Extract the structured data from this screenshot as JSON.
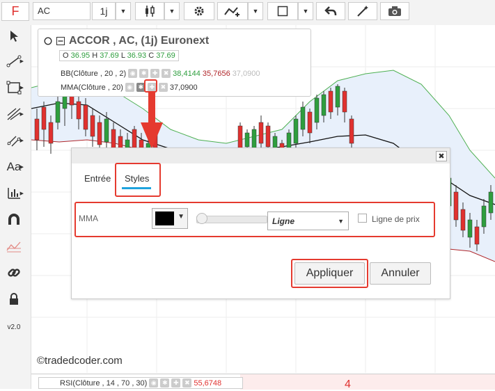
{
  "toolbar": {
    "logo": "F",
    "symbol": "AC",
    "period": "1j"
  },
  "sidebar": {
    "version": "v2.0"
  },
  "legend": {
    "title": "ACCOR , AC, (1j) Euronext",
    "ohlc": {
      "o_label": "O",
      "o_value": "36.95",
      "h_label": "H",
      "h_value": "37.69",
      "l_label": "L",
      "l_value": "36.93",
      "c_label": "C",
      "c_value": "37.69"
    },
    "bb": {
      "name": "BB(Clôture , 20 , 2)",
      "v1": "38,4144",
      "v2": "35,7656",
      "v3": "37,0900"
    },
    "mma": {
      "name": "MMA(Clôture , 20)",
      "v1": "37,0900"
    }
  },
  "dialog": {
    "tab_entree": "Entrée",
    "tab_styles": "Styles",
    "row_label": "MMA",
    "line_type": "Ligne",
    "price_line_label": "Ligne de prix",
    "apply": "Appliquer",
    "cancel": "Annuler",
    "close": "✖"
  },
  "watermark": "©tradedcoder.com",
  "rsi": {
    "name": "RSI(Clôture , 14 , 70 , 30)",
    "value": "55,6748",
    "axis_mark": "4"
  },
  "colors": {
    "up": "#2e9e3e",
    "down": "#e0312f",
    "bb_fill": "#e8f0fb",
    "accent_red": "#e53a2f",
    "tab_underline": "#1fa3dd"
  }
}
